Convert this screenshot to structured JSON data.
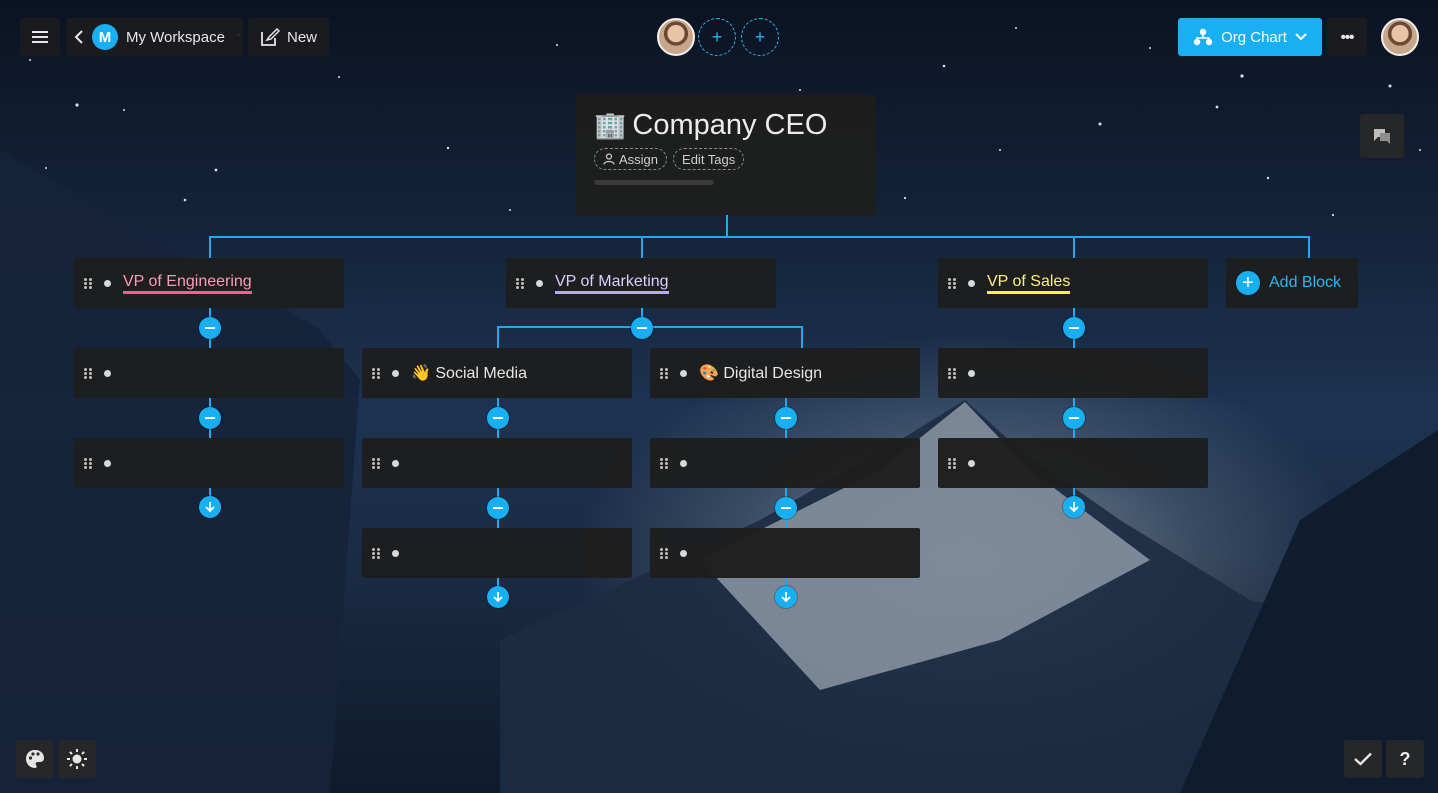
{
  "topbar": {
    "workspace_initial": "M",
    "workspace_label": "My Workspace",
    "new_label": "New",
    "add_member_symbol": "+",
    "view_label": "Org Chart",
    "more_symbol": "•••"
  },
  "chart": {
    "root": {
      "emoji": "🏢",
      "title": "Company CEO",
      "assign_label": "Assign",
      "edit_tags_label": "Edit Tags"
    },
    "columns": [
      {
        "head": "VP of Engineering",
        "head_underline": "#ff5b8f",
        "children": [
          "",
          ""
        ]
      },
      {
        "head": "VP of Marketing",
        "head_underline": "#b9a7ff",
        "subcolumns": [
          {
            "label": "👋 Social Media",
            "children": [
              "",
              ""
            ]
          },
          {
            "label": "🎨 Digital Design",
            "children": [
              "",
              ""
            ]
          }
        ]
      },
      {
        "head": "VP of Sales",
        "head_underline": "#fff23a",
        "children": [
          "",
          ""
        ]
      }
    ],
    "add_block_label": "Add Block"
  },
  "bottom": {
    "help_symbol": "?"
  },
  "colors": {
    "accent": "#18b0f2",
    "block_bg": "#1e1e1e",
    "line": "#1eaaf1"
  },
  "icons": [
    "menu-icon",
    "back-icon",
    "new-note-icon",
    "org-chart-icon",
    "chevron-down-icon",
    "comment-icon",
    "palette-icon",
    "brightness-icon",
    "check-icon",
    "help-icon",
    "drag-handle-icon"
  ]
}
